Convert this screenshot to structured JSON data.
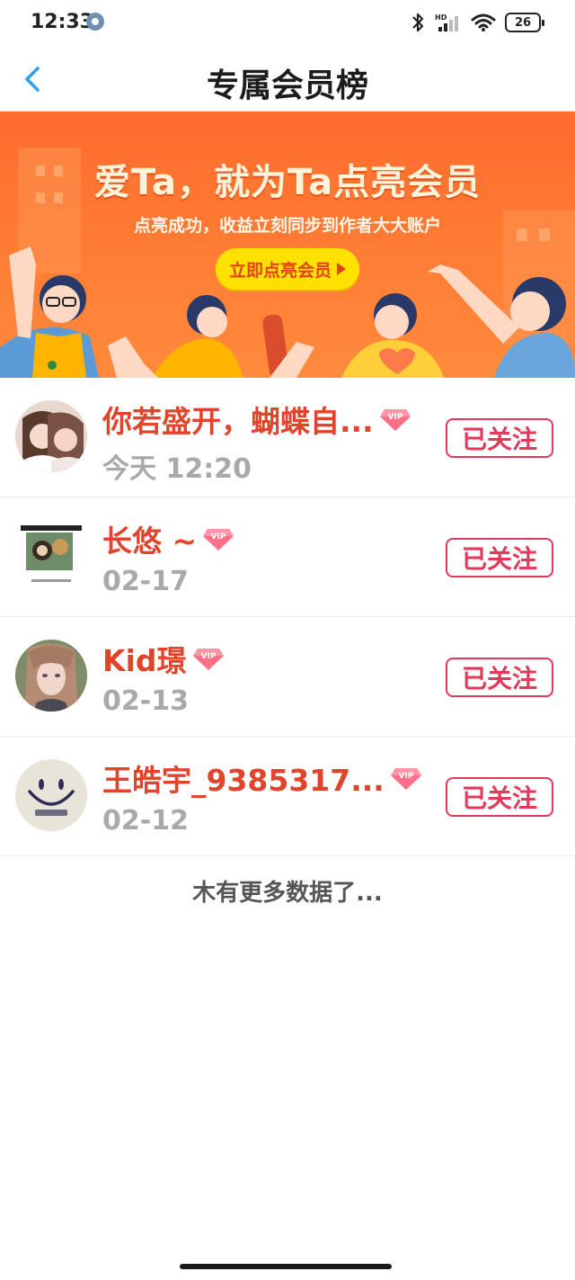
{
  "status_bar": {
    "time": "12:33",
    "battery": "26",
    "network": "HD"
  },
  "header": {
    "title": "专属会员榜"
  },
  "banner": {
    "title": "爱Ta，就为Ta点亮会员",
    "subtitle": "点亮成功，收益立刻同步到作者大大账户",
    "button_label": "立即点亮会员"
  },
  "members": [
    {
      "name": "你若盛开，蝴蝶自...",
      "date": "今天 12:20",
      "follow_label": "已关注",
      "vip_label": "VIP"
    },
    {
      "name": "长悠 ~",
      "date": "02-17",
      "follow_label": "已关注",
      "vip_label": "VIP"
    },
    {
      "name": "Kid璟",
      "date": "02-13",
      "follow_label": "已关注",
      "vip_label": "VIP"
    },
    {
      "name": "王皓宇_9385317...",
      "date": "02-12",
      "follow_label": "已关注",
      "vip_label": "VIP"
    }
  ],
  "footer": {
    "no_more_text": "木有更多数据了..."
  },
  "colors": {
    "name": "#e0452c",
    "follow": "#e23a5b",
    "banner": "#ff7a33",
    "button": "#ffe100"
  }
}
